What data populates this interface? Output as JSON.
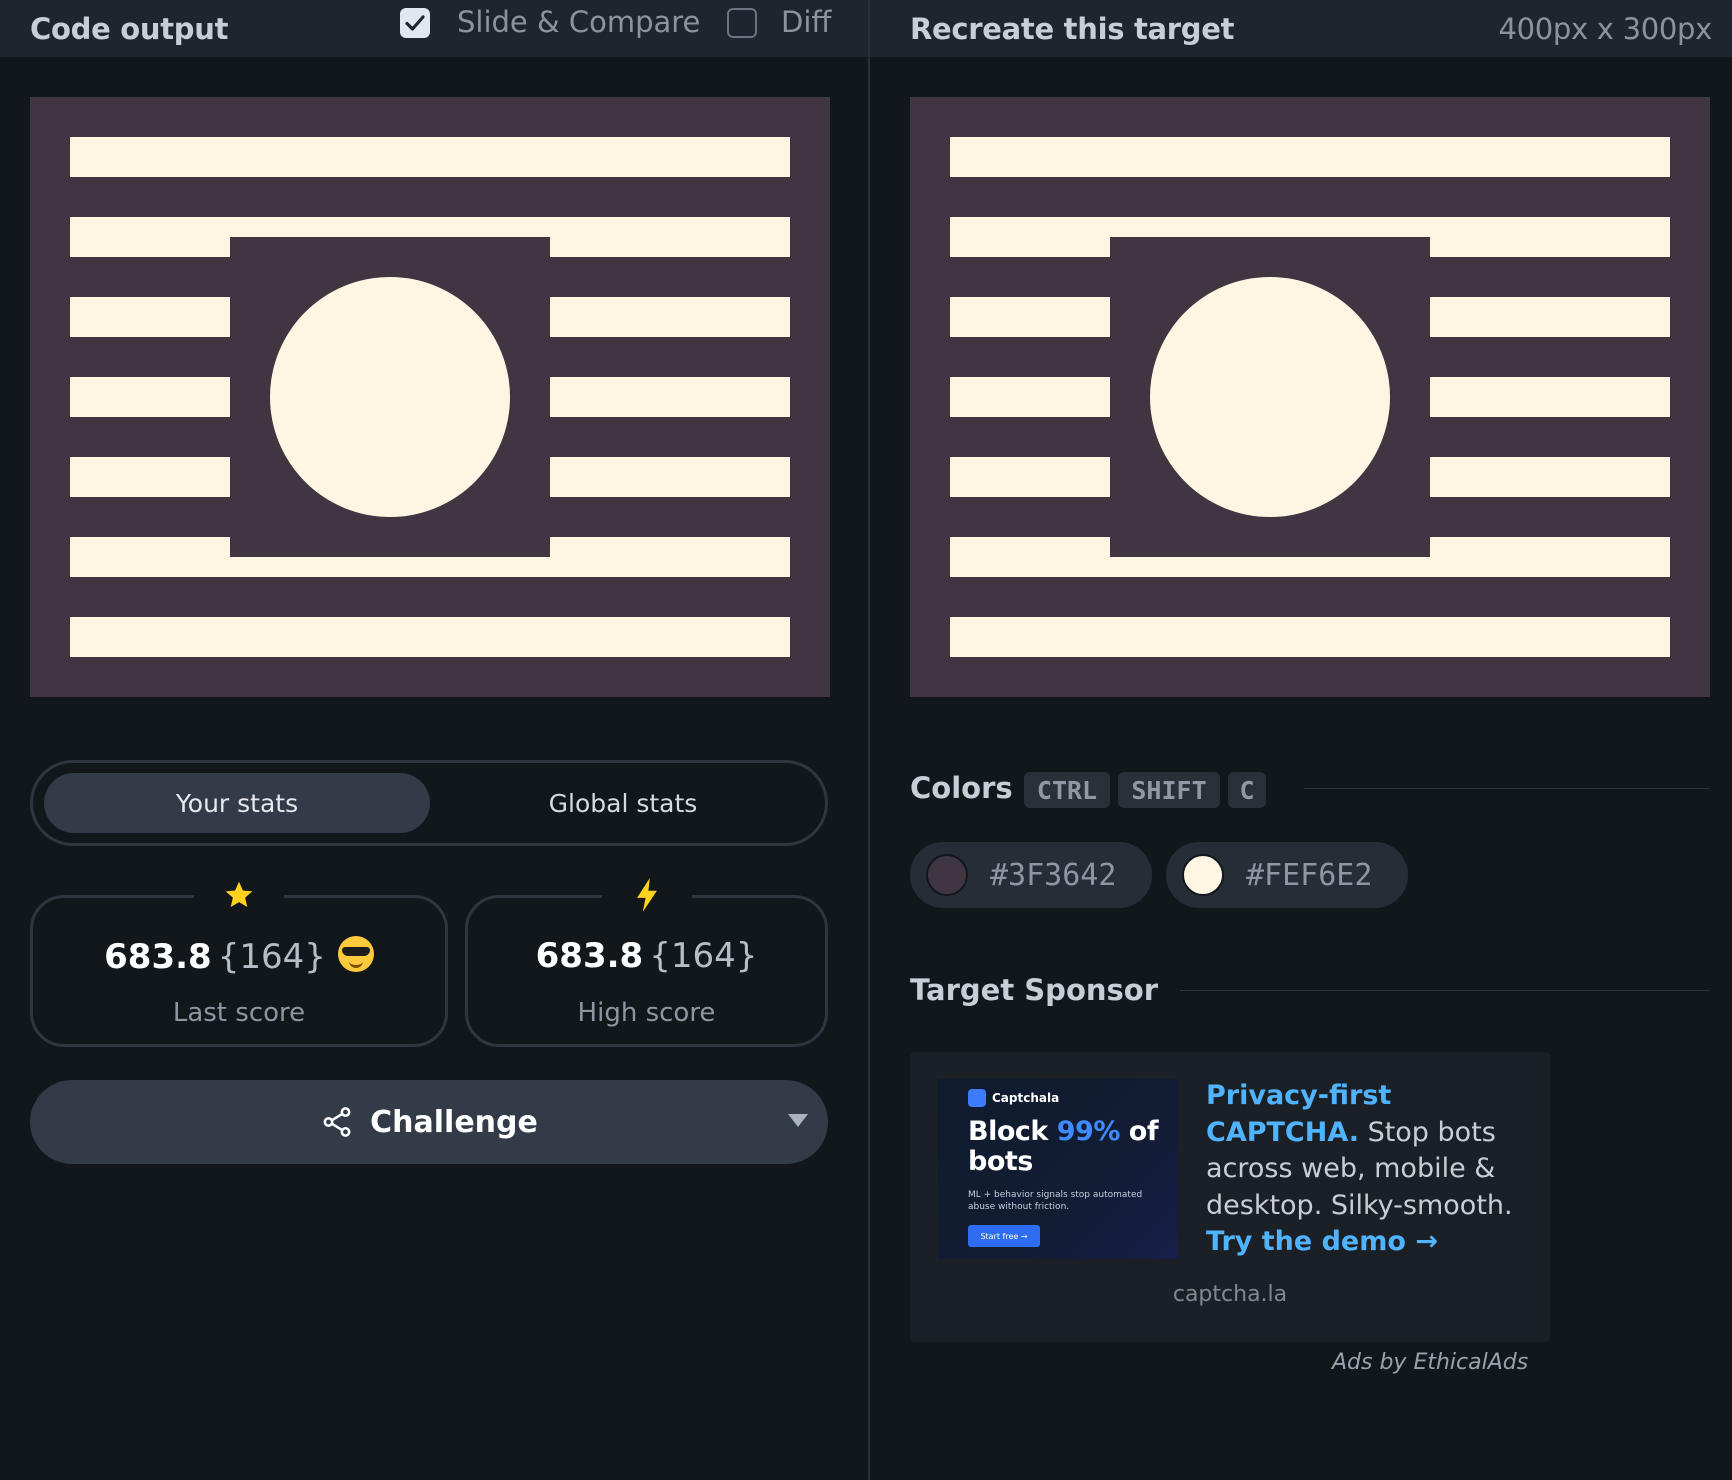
{
  "left_panel": {
    "title": "Code output",
    "slide_compare": {
      "label": "Slide & Compare",
      "checked": true
    },
    "diff": {
      "label": "Diff",
      "checked": false
    }
  },
  "right_panel": {
    "title": "Recreate this target",
    "dimensions": "400px x 300px"
  },
  "stats_tabs": {
    "your_stats": "Your stats",
    "global_stats": "Global stats",
    "active": "Your stats"
  },
  "stats": {
    "last": {
      "score": "683.8",
      "chars": "{164}",
      "label": "Last score",
      "badge_icon": "star-icon",
      "emoji": "sunglasses-emoji"
    },
    "high": {
      "score": "683.8",
      "chars": "{164}",
      "label": "High score",
      "badge_icon": "lightning-icon"
    }
  },
  "challenge": {
    "label": "Challenge",
    "icon": "share-icon"
  },
  "colors_section": {
    "title": "Colors",
    "shortcut": [
      "CTRL",
      "SHIFT",
      "C"
    ],
    "swatches": [
      {
        "hex": "#3F3642",
        "label": "#3F3642"
      },
      {
        "hex": "#FEF6E2",
        "label": "#FEF6E2"
      }
    ]
  },
  "sponsor": {
    "title": "Target Sponsor",
    "ad_image": {
      "brand": "Captchala",
      "headline_pre": "Block ",
      "headline_hl": "99%",
      "headline_post": " of bots",
      "fine_print": "ML + behavior signals stop automated abuse without friction.",
      "button": "Start free →"
    },
    "ad_text": {
      "lead": "Privacy-first CAPTCHA.",
      "body": " Stop bots across web, mobile & desktop. Silky-smooth. ",
      "cta": "Try the demo →"
    },
    "domain": "captcha.la",
    "network": "Ads by EthicalAds"
  },
  "colors": {
    "background": "#3F3642",
    "foreground": "#FEF6E2",
    "app_bg": "#12171c",
    "accent_blue": "#4fb3ff"
  }
}
